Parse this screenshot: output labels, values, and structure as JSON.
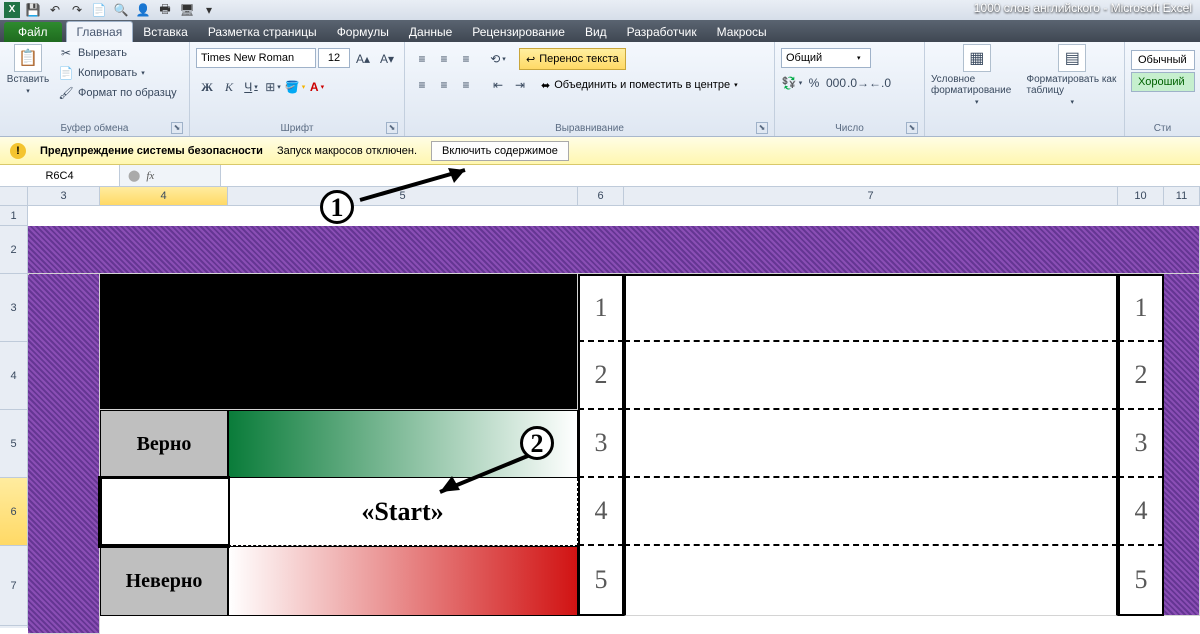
{
  "title": "1000 слов английского - Microsoft Excel",
  "tabs": {
    "file": "Файл",
    "home": "Главная",
    "insert": "Вставка",
    "layout": "Разметка страницы",
    "formulas": "Формулы",
    "data": "Данные",
    "review": "Рецензирование",
    "view": "Вид",
    "dev": "Разработчик",
    "macros": "Макросы"
  },
  "clipboard": {
    "paste": "Вставить",
    "cut": "Вырезать",
    "copy": "Копировать",
    "painter": "Формат по образцу",
    "label": "Буфер обмена"
  },
  "font": {
    "name": "Times New Roman",
    "size": "12",
    "label": "Шрифт"
  },
  "align": {
    "wrap": "Перенос текста",
    "merge": "Объединить и поместить в центре",
    "label": "Выравнивание"
  },
  "number": {
    "fmt": "Общий",
    "label": "Число"
  },
  "styles": {
    "cond": "Условное форматирование",
    "table": "Форматировать как таблицу",
    "normal": "Обычный",
    "good": "Хороший",
    "label": "Сти"
  },
  "warn": {
    "title": "Предупреждение системы безопасности",
    "msg": "Запуск макросов отключен.",
    "btn": "Включить содержимое"
  },
  "namebox": "R6C4",
  "cols": [
    "3",
    "4",
    "5",
    "6",
    "7",
    "10",
    "11"
  ],
  "rows": [
    "1",
    "2",
    "3",
    "4",
    "5",
    "6",
    "7"
  ],
  "content": {
    "verno": "Верно",
    "neverno": "Неверно",
    "start": "«Start»"
  },
  "nums": [
    "1",
    "2",
    "3",
    "4",
    "5"
  ],
  "annot": {
    "n1": "1",
    "n2": "2"
  }
}
